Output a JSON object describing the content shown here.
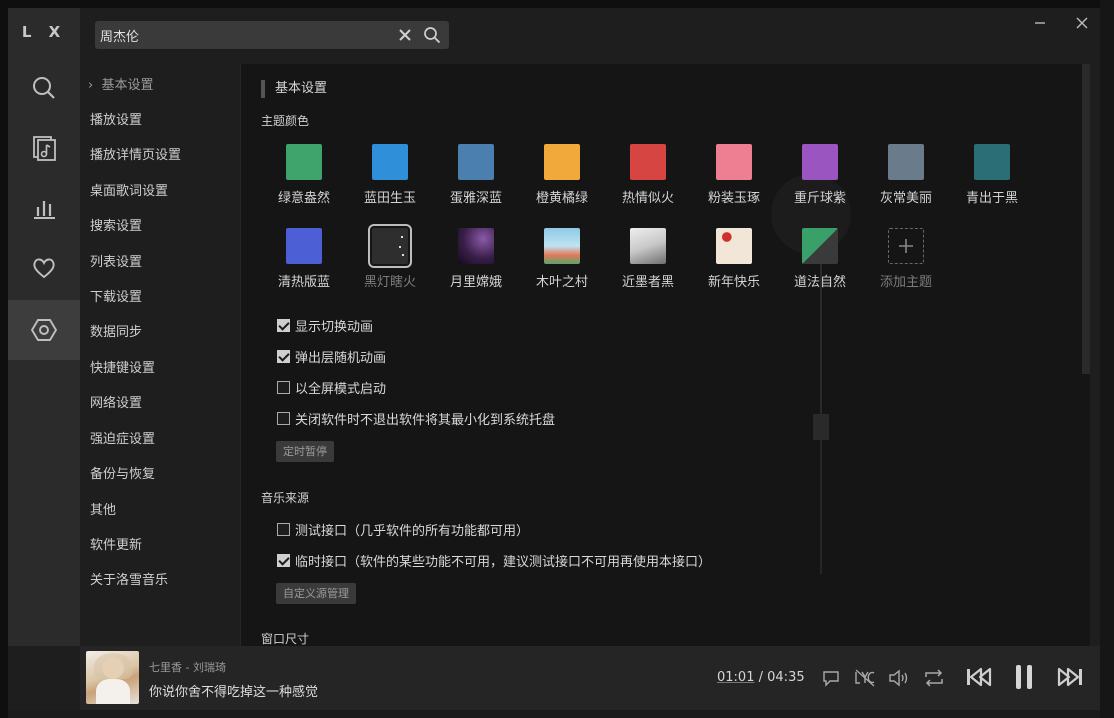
{
  "app": {
    "logo": "L X"
  },
  "search": {
    "value": "周杰伦"
  },
  "settings_nav": {
    "active_marker": "›",
    "items": [
      "基本设置",
      "播放设置",
      "播放详情页设置",
      "桌面歌词设置",
      "搜索设置",
      "列表设置",
      "下载设置",
      "数据同步",
      "快捷键设置",
      "网络设置",
      "强迫症设置",
      "备份与恢复",
      "其他",
      "软件更新",
      "关于洛雪音乐"
    ]
  },
  "basic": {
    "header": "基本设置",
    "theme_label": "主题颜色",
    "themes_row1": [
      {
        "name": "绿意盎然",
        "color": "#3fa36c"
      },
      {
        "name": "蓝田生玉",
        "color": "#2f8fd8"
      },
      {
        "name": "蛋雅深蓝",
        "color": "#4a7fb0"
      },
      {
        "name": "橙黄橘绿",
        "color": "#f2a93b"
      },
      {
        "name": "热情似火",
        "color": "#d64541"
      },
      {
        "name": "粉装玉琢",
        "color": "#ee7f93"
      },
      {
        "name": "重斤球紫",
        "color": "#9a55c0"
      },
      {
        "name": "灰常美丽",
        "color": "#6a7b8c"
      },
      {
        "name": "青出于黑",
        "color": "#2c6e76"
      }
    ],
    "themes_row2": [
      {
        "name": "清热版蓝",
        "color": "#4d5fd4"
      },
      {
        "name": "黑灯瞎火",
        "color": "#2e2e2e",
        "selected": true
      },
      {
        "name": "月里嫦娥",
        "color": "#3a1f4a"
      },
      {
        "name": "木叶之村",
        "color": "#8fc9e6"
      },
      {
        "name": "近墨者黑",
        "color": "#c9c9c9"
      },
      {
        "name": "新年快乐",
        "color": "#f2e6d8"
      },
      {
        "name": "道法自然",
        "color": "#3aa06a"
      }
    ],
    "add_theme": "添加主题",
    "checkboxes": [
      {
        "label": "显示切换动画",
        "checked": true
      },
      {
        "label": "弹出层随机动画",
        "checked": true
      },
      {
        "label": "以全屏模式启动",
        "checked": false
      },
      {
        "label": "关闭软件时不退出软件将其最小化到系统托盘",
        "checked": false
      }
    ],
    "timer_button": "定时暂停",
    "music_source_label": "音乐来源",
    "sources": [
      {
        "label": "测试接口（几乎软件的所有功能都可用）",
        "checked": false
      },
      {
        "label": "临时接口（软件的某些功能不可用，建议测试接口不可用再使用本接口）",
        "checked": true
      }
    ],
    "custom_source_button": "自定义源管理",
    "window_size_label": "窗口尺寸"
  },
  "player": {
    "title": "七里香 - 刘瑞琦",
    "lyric": "你说你舍不得吃掉这一种感觉",
    "current_time": "01:01",
    "separator": "/",
    "total_time": "04:35"
  }
}
